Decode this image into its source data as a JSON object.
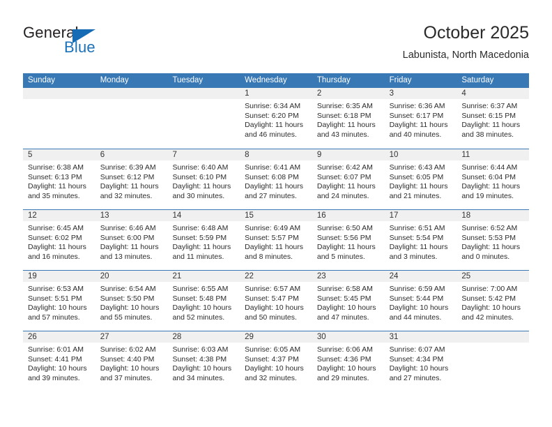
{
  "brand": {
    "name_dark": "General",
    "name_blue": "Blue",
    "accent_color": "#1b72b8",
    "header_color": "#3778b5"
  },
  "header": {
    "month_title": "October 2025",
    "location": "Labunista, North Macedonia"
  },
  "calendar": {
    "weekdays": [
      "Sunday",
      "Monday",
      "Tuesday",
      "Wednesday",
      "Thursday",
      "Friday",
      "Saturday"
    ],
    "weeks": [
      [
        {
          "day": "",
          "empty": true
        },
        {
          "day": "",
          "empty": true
        },
        {
          "day": "",
          "empty": true
        },
        {
          "day": "1",
          "sunrise": "Sunrise: 6:34 AM",
          "sunset": "Sunset: 6:20 PM",
          "daylight_line1": "Daylight: 11 hours",
          "daylight_line2": "and 46 minutes."
        },
        {
          "day": "2",
          "sunrise": "Sunrise: 6:35 AM",
          "sunset": "Sunset: 6:18 PM",
          "daylight_line1": "Daylight: 11 hours",
          "daylight_line2": "and 43 minutes."
        },
        {
          "day": "3",
          "sunrise": "Sunrise: 6:36 AM",
          "sunset": "Sunset: 6:17 PM",
          "daylight_line1": "Daylight: 11 hours",
          "daylight_line2": "and 40 minutes."
        },
        {
          "day": "4",
          "sunrise": "Sunrise: 6:37 AM",
          "sunset": "Sunset: 6:15 PM",
          "daylight_line1": "Daylight: 11 hours",
          "daylight_line2": "and 38 minutes."
        }
      ],
      [
        {
          "day": "5",
          "sunrise": "Sunrise: 6:38 AM",
          "sunset": "Sunset: 6:13 PM",
          "daylight_line1": "Daylight: 11 hours",
          "daylight_line2": "and 35 minutes."
        },
        {
          "day": "6",
          "sunrise": "Sunrise: 6:39 AM",
          "sunset": "Sunset: 6:12 PM",
          "daylight_line1": "Daylight: 11 hours",
          "daylight_line2": "and 32 minutes."
        },
        {
          "day": "7",
          "sunrise": "Sunrise: 6:40 AM",
          "sunset": "Sunset: 6:10 PM",
          "daylight_line1": "Daylight: 11 hours",
          "daylight_line2": "and 30 minutes."
        },
        {
          "day": "8",
          "sunrise": "Sunrise: 6:41 AM",
          "sunset": "Sunset: 6:08 PM",
          "daylight_line1": "Daylight: 11 hours",
          "daylight_line2": "and 27 minutes."
        },
        {
          "day": "9",
          "sunrise": "Sunrise: 6:42 AM",
          "sunset": "Sunset: 6:07 PM",
          "daylight_line1": "Daylight: 11 hours",
          "daylight_line2": "and 24 minutes."
        },
        {
          "day": "10",
          "sunrise": "Sunrise: 6:43 AM",
          "sunset": "Sunset: 6:05 PM",
          "daylight_line1": "Daylight: 11 hours",
          "daylight_line2": "and 21 minutes."
        },
        {
          "day": "11",
          "sunrise": "Sunrise: 6:44 AM",
          "sunset": "Sunset: 6:04 PM",
          "daylight_line1": "Daylight: 11 hours",
          "daylight_line2": "and 19 minutes."
        }
      ],
      [
        {
          "day": "12",
          "sunrise": "Sunrise: 6:45 AM",
          "sunset": "Sunset: 6:02 PM",
          "daylight_line1": "Daylight: 11 hours",
          "daylight_line2": "and 16 minutes."
        },
        {
          "day": "13",
          "sunrise": "Sunrise: 6:46 AM",
          "sunset": "Sunset: 6:00 PM",
          "daylight_line1": "Daylight: 11 hours",
          "daylight_line2": "and 13 minutes."
        },
        {
          "day": "14",
          "sunrise": "Sunrise: 6:48 AM",
          "sunset": "Sunset: 5:59 PM",
          "daylight_line1": "Daylight: 11 hours",
          "daylight_line2": "and 11 minutes."
        },
        {
          "day": "15",
          "sunrise": "Sunrise: 6:49 AM",
          "sunset": "Sunset: 5:57 PM",
          "daylight_line1": "Daylight: 11 hours",
          "daylight_line2": "and 8 minutes."
        },
        {
          "day": "16",
          "sunrise": "Sunrise: 6:50 AM",
          "sunset": "Sunset: 5:56 PM",
          "daylight_line1": "Daylight: 11 hours",
          "daylight_line2": "and 5 minutes."
        },
        {
          "day": "17",
          "sunrise": "Sunrise: 6:51 AM",
          "sunset": "Sunset: 5:54 PM",
          "daylight_line1": "Daylight: 11 hours",
          "daylight_line2": "and 3 minutes."
        },
        {
          "day": "18",
          "sunrise": "Sunrise: 6:52 AM",
          "sunset": "Sunset: 5:53 PM",
          "daylight_line1": "Daylight: 11 hours",
          "daylight_line2": "and 0 minutes."
        }
      ],
      [
        {
          "day": "19",
          "sunrise": "Sunrise: 6:53 AM",
          "sunset": "Sunset: 5:51 PM",
          "daylight_line1": "Daylight: 10 hours",
          "daylight_line2": "and 57 minutes."
        },
        {
          "day": "20",
          "sunrise": "Sunrise: 6:54 AM",
          "sunset": "Sunset: 5:50 PM",
          "daylight_line1": "Daylight: 10 hours",
          "daylight_line2": "and 55 minutes."
        },
        {
          "day": "21",
          "sunrise": "Sunrise: 6:55 AM",
          "sunset": "Sunset: 5:48 PM",
          "daylight_line1": "Daylight: 10 hours",
          "daylight_line2": "and 52 minutes."
        },
        {
          "day": "22",
          "sunrise": "Sunrise: 6:57 AM",
          "sunset": "Sunset: 5:47 PM",
          "daylight_line1": "Daylight: 10 hours",
          "daylight_line2": "and 50 minutes."
        },
        {
          "day": "23",
          "sunrise": "Sunrise: 6:58 AM",
          "sunset": "Sunset: 5:45 PM",
          "daylight_line1": "Daylight: 10 hours",
          "daylight_line2": "and 47 minutes."
        },
        {
          "day": "24",
          "sunrise": "Sunrise: 6:59 AM",
          "sunset": "Sunset: 5:44 PM",
          "daylight_line1": "Daylight: 10 hours",
          "daylight_line2": "and 44 minutes."
        },
        {
          "day": "25",
          "sunrise": "Sunrise: 7:00 AM",
          "sunset": "Sunset: 5:42 PM",
          "daylight_line1": "Daylight: 10 hours",
          "daylight_line2": "and 42 minutes."
        }
      ],
      [
        {
          "day": "26",
          "sunrise": "Sunrise: 6:01 AM",
          "sunset": "Sunset: 4:41 PM",
          "daylight_line1": "Daylight: 10 hours",
          "daylight_line2": "and 39 minutes."
        },
        {
          "day": "27",
          "sunrise": "Sunrise: 6:02 AM",
          "sunset": "Sunset: 4:40 PM",
          "daylight_line1": "Daylight: 10 hours",
          "daylight_line2": "and 37 minutes."
        },
        {
          "day": "28",
          "sunrise": "Sunrise: 6:03 AM",
          "sunset": "Sunset: 4:38 PM",
          "daylight_line1": "Daylight: 10 hours",
          "daylight_line2": "and 34 minutes."
        },
        {
          "day": "29",
          "sunrise": "Sunrise: 6:05 AM",
          "sunset": "Sunset: 4:37 PM",
          "daylight_line1": "Daylight: 10 hours",
          "daylight_line2": "and 32 minutes."
        },
        {
          "day": "30",
          "sunrise": "Sunrise: 6:06 AM",
          "sunset": "Sunset: 4:36 PM",
          "daylight_line1": "Daylight: 10 hours",
          "daylight_line2": "and 29 minutes."
        },
        {
          "day": "31",
          "sunrise": "Sunrise: 6:07 AM",
          "sunset": "Sunset: 4:34 PM",
          "daylight_line1": "Daylight: 10 hours",
          "daylight_line2": "and 27 minutes."
        },
        {
          "day": "",
          "empty": true
        }
      ]
    ]
  }
}
